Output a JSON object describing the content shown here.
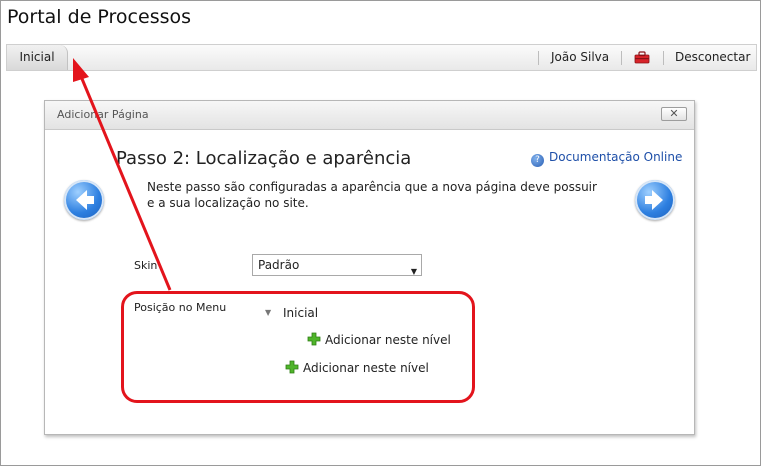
{
  "app": {
    "title": "Portal de Processos"
  },
  "topbar": {
    "tab_label": "Inicial",
    "user_label": "João Silva",
    "toolbox_icon": "toolbox-icon",
    "logout_label": "Desconectar"
  },
  "dialog": {
    "title": "Adicionar Página",
    "close_icon": "close-icon",
    "step_title": "Passo 2: Localização e aparência",
    "help_label": "Documentação Online",
    "description": "Neste passo são configuradas a aparência que a nova página deve possuir e a sua localização no site.",
    "skin_label": "Skin",
    "skin_value": "Padrão",
    "menu_position_label": "Posição no Menu",
    "tree": {
      "root_label": "Inicial",
      "add_child_label": "Adicionar neste nível",
      "add_sibling_label": "Adicionar neste nível"
    }
  },
  "colors": {
    "annotation_red": "#e3141c",
    "nav_blue": "#2d7fe0",
    "plus_green": "#44aa22",
    "link_blue": "#1e4fa8"
  }
}
